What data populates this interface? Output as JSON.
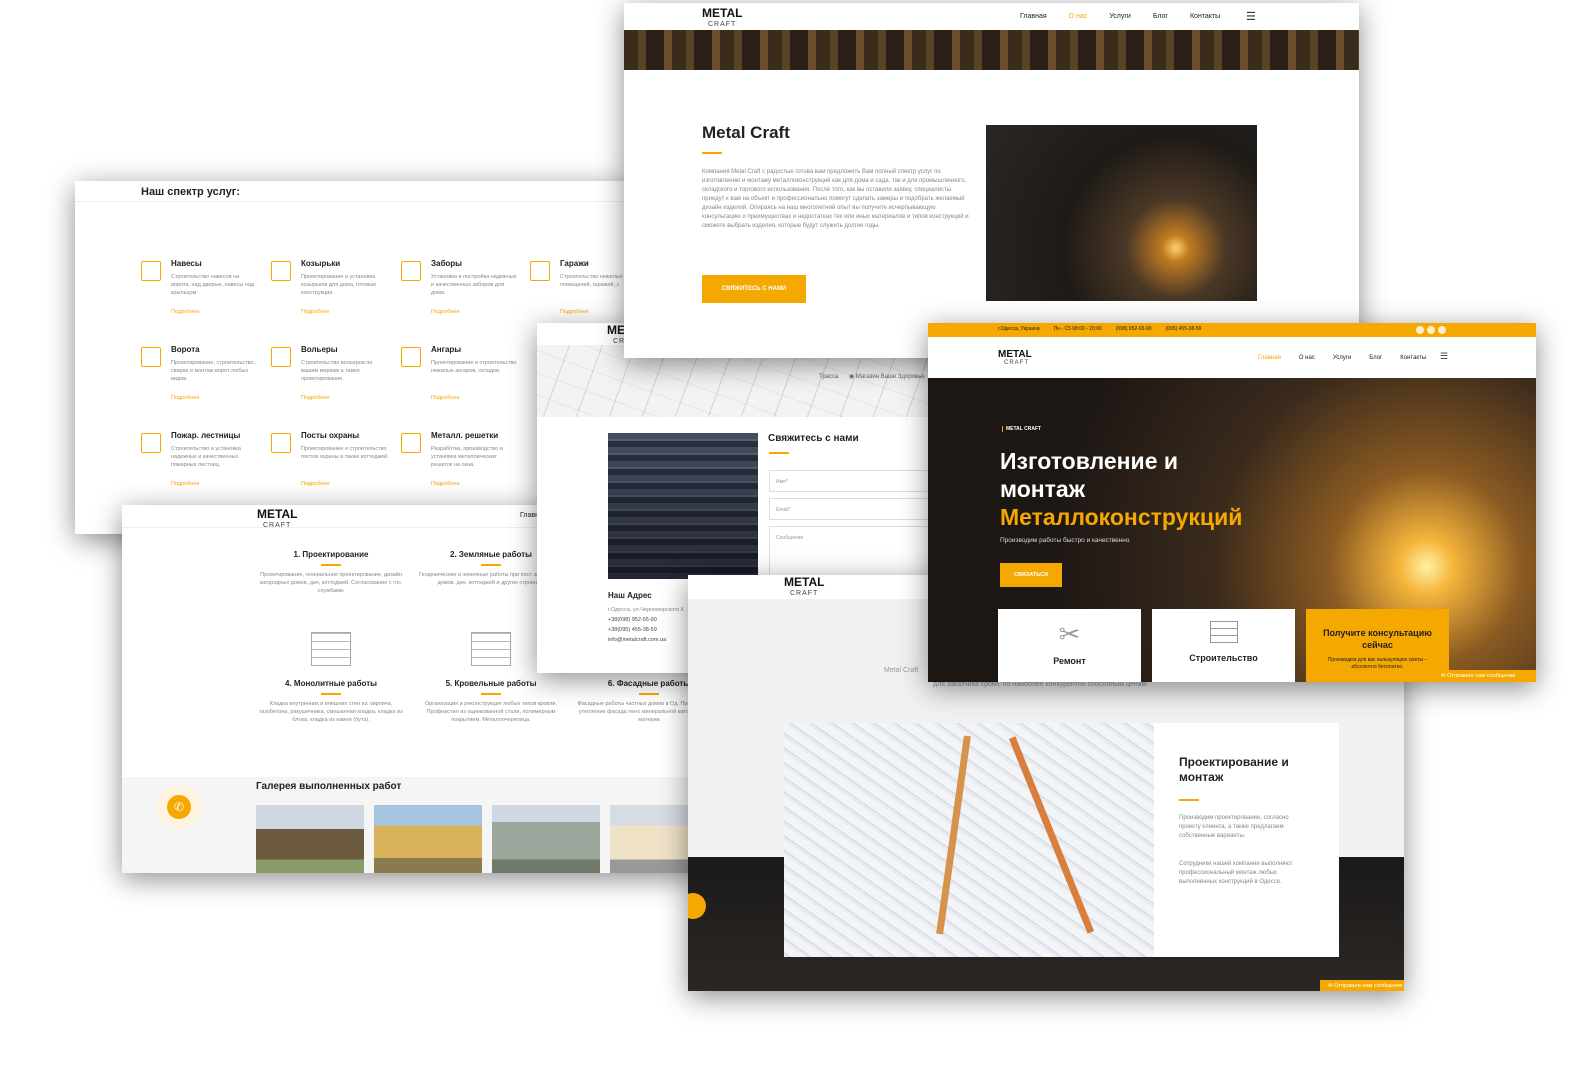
{
  "about": {
    "logo_top": "METAL",
    "logo_sub": "CRAFT",
    "nav": [
      "Главная",
      "О нас",
      "Услуги",
      "Блог",
      "Контакты"
    ],
    "title": "Metal Craft",
    "text": "Компания Metal Craft с радостью готова вам предложить Вам полный спектр услуг по изготовлению и монтажу металлоконструкций как для дома и сада, так и для промышленного, складского и торгового использования. После того, как вы оставили заявку, специалисты приедут к вам на объект и профессионально помогут сделать замеры и подобрать желаемый дизайн изделий. Опираясь на наш многолетний опыт вы получите исчерпывающую консультацию о преимуществах и недостатках тех или иных материалов и типов конструкций и сможете выбрать изделия, которые будут служить долгие годы.",
    "button": "СВЯЖИТЕСЬ С НАМИ"
  },
  "services": {
    "title": "Наш спектр услуг:",
    "more": "Подробнее",
    "items": [
      {
        "t": "Навесы",
        "d": "Строительство навесов на ворота, над дверью, навесы над крыльцом"
      },
      {
        "t": "Козырьки",
        "d": "Проектирование и установка козырьков для дома, готовые конструкции."
      },
      {
        "t": "Заборы",
        "d": "Установка и постройка надежных и качественных заборов для дома."
      },
      {
        "t": "Гаражи",
        "d": "Строительство нежилых помещений, гаражей, с"
      },
      {
        "t": "Ворота",
        "d": "Проектирование, строительство , сварка и монтаж ворот любых видов."
      },
      {
        "t": "Вольеры",
        "d": "Строительство вольеров по вашим меркам а также проектирование."
      },
      {
        "t": "Ангары",
        "d": "Проектирование и строительство нежилых ангаров, складов."
      },
      {
        "t": "Пожар. лестницы",
        "d": "Строительство и установка надежных и качественных пожарных лестниц."
      },
      {
        "t": "Посты охраны",
        "d": "Проектирование и строительство постов охраны а также коттеджей."
      },
      {
        "t": "Металл. решетки",
        "d": "Разработка, производство и установка металлических решеток на окна."
      }
    ]
  },
  "works": {
    "logo_top": "METAL",
    "logo_sub": "CRAFT",
    "nav_cut": "Главн",
    "items": [
      {
        "t": "1. Проектирование",
        "d": "Проектирование, генеральное проектирование, дизайн загородных домов, дач, коттеджей. Согласование с гос. службами."
      },
      {
        "t": "2. Земляные работы",
        "d": "Геодезические и земляные работы при пост загородных домов, дач, коттеджей и других строений."
      },
      {
        "t": "4. Монолитные работы",
        "d": "Кладка внутренних и внешних стен из: кирпича, газобетона, ракушечника, смешанная кладка, кладка из блока, кладка из камня (бута)."
      },
      {
        "t": "5. Кровельные работы",
        "d": "Организация и реконструкция любых типов кровли. Профнастил из оцинкованной стали, полимерным покрытием. Металлочерепица."
      },
      {
        "t": "6. Фасадные работы",
        "d": "Фасадные работы частных домов в Од. Преимущества: утепление фасада пено минеральной ватой и другими материа"
      }
    ],
    "gallery_title": "Галерея выполненных работ"
  },
  "contact": {
    "logo_top": "ME",
    "logo_sub": "CR",
    "map1": "Трасса",
    "map2": "Магазин Ваше Здоровье",
    "title": "Свяжитесь с нами",
    "name": "Имя*",
    "email": "Email*",
    "msg": "Сообщение",
    "addr_title": "Наш Адрес",
    "addr": [
      "г.Одесса, ул.Черноморского К",
      "+38(098) 952-65-90",
      "+38(095) 455-38-59",
      "info@metalcraft.com.ua"
    ]
  },
  "project": {
    "logo_top": "METAL",
    "logo_sub": "CRAFT",
    "brand": "Metal Craft",
    "line": "для заказчика сроки, по наиболее конкурентно способным ценам.",
    "title": "Проектирование и монтаж",
    "p1": "Производим проектирование, согласно проекту клиента, а также предлагаем собственные варианты.",
    "p2": "Сотрудники нашей компании выполняют профессиональный монтаж любых выполненных конструкций в Одессе.",
    "chat": "Отправьте нам сообщение"
  },
  "home": {
    "topbar": [
      "г.Одесса, Украина",
      "Пн - С5 08:00 - 20:00",
      "(098) 952-65-90",
      "(095) 455-38-59"
    ],
    "logo_top": "METAL",
    "logo_sub": "CRAFT",
    "nav": [
      "Главная",
      "О нас",
      "Услуги",
      "Блог",
      "Контакты"
    ],
    "brand": "METAL CRAFT",
    "h1a": "Изготовление и",
    "h1b": "монтаж",
    "h1c": "Металлоконструкций",
    "sub": "Производим работы быстро и качественно",
    "button": "СВЯЗАТЬСЯ",
    "box1": "Ремонт",
    "box2": "Строительство",
    "box3t": "Получите консультацию сейчас",
    "box3d": "Произведем для вас калькуляцию сметы – абсолютно бесплатно.",
    "chat": "Отправьте нам сообщение"
  }
}
